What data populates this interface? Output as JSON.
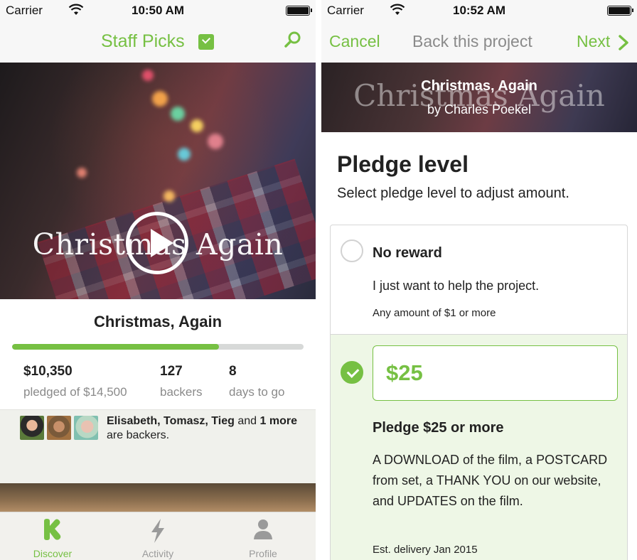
{
  "left": {
    "status": {
      "carrier": "Carrier",
      "time": "10:50 AM"
    },
    "nav": {
      "title": "Staff Picks"
    },
    "hero": {
      "title": "Christmas Again"
    },
    "project": {
      "title": "Christmas, Again",
      "funded_fraction": 0.71,
      "pledged": "$10,350",
      "pledged_label": "pledged of $14,500",
      "backers": "127",
      "backers_label": "backers",
      "days": "8",
      "days_label": "days to go"
    },
    "friends": {
      "names": "Elisabeth, Tomasz, Tieg",
      "and": "and",
      "more": "1 more",
      "suffix": "are backers."
    },
    "tabs": [
      {
        "label": "Discover",
        "icon": "kickstarter-k-icon"
      },
      {
        "label": "Activity",
        "icon": "lightning-icon"
      },
      {
        "label": "Profile",
        "icon": "person-icon"
      }
    ]
  },
  "right": {
    "status": {
      "carrier": "Carrier",
      "time": "10:52 AM"
    },
    "nav": {
      "cancel": "Cancel",
      "title": "Back this project",
      "next": "Next"
    },
    "hero": {
      "bg_title": "Christmas Again",
      "title": "Christmas, Again",
      "subtitle": "by Charles Poekel"
    },
    "pledge": {
      "heading": "Pledge level",
      "instructions": "Select pledge level to adjust amount.",
      "no_reward": {
        "title": "No reward",
        "desc": "I just want to help the project.",
        "min": "Any amount of $1 or more"
      },
      "selected": {
        "amount": "$25",
        "title": "Pledge $25 or more",
        "desc": "A DOWNLOAD of the film, a POSTCARD from set, a THANK YOU on our website, and UPDATES on the film.",
        "delivery": "Est. delivery Jan 2015"
      }
    }
  },
  "colors": {
    "accent": "#76c043",
    "muted": "#8a8a8a",
    "selected_bg": "#eef7e6"
  }
}
